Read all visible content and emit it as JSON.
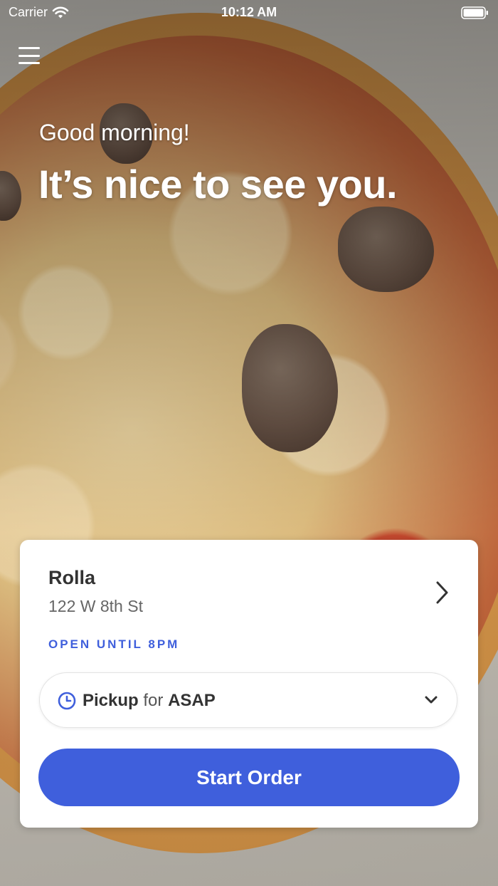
{
  "status_bar": {
    "carrier": "Carrier",
    "time": "10:12 AM",
    "icons": [
      "wifi-icon",
      "battery-icon"
    ]
  },
  "header": {
    "menu_icon": "hamburger-menu-icon",
    "greeting": "Good morning!",
    "headline": "It’s nice to see you."
  },
  "store_card": {
    "name": "Rolla",
    "address": "122 W 8th St",
    "hours_status": "OPEN UNTIL 8PM",
    "chevron_icon": "chevron-right-icon",
    "order_type": {
      "icon": "clock-icon",
      "mode": "Pickup",
      "connector": "for",
      "time": "ASAP",
      "dropdown_icon": "chevron-down-icon"
    },
    "start_order_label": "Start Order"
  },
  "colors": {
    "accent": "#3f5fdc",
    "card_background": "#ffffff",
    "primary_text": "#333333",
    "secondary_text": "#666666"
  }
}
